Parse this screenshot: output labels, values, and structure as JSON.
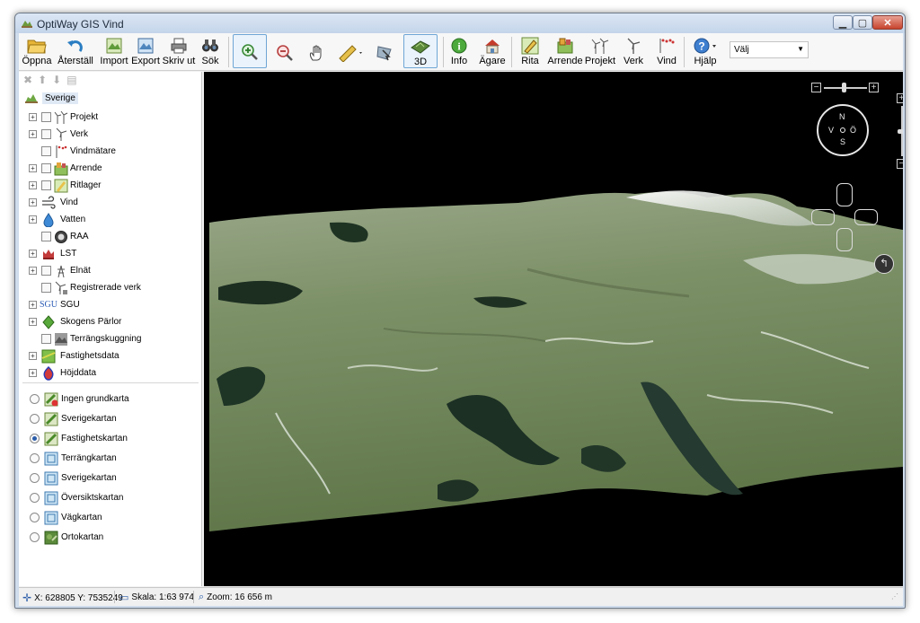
{
  "window": {
    "title": "OptiWay GIS Vind"
  },
  "toolbar": {
    "open": "Öppna",
    "reset": "Återställ",
    "import": "Import",
    "export": "Export",
    "print": "Skriv ut",
    "search": "Sök",
    "view3d": "3D",
    "info": "Info",
    "owner": "Ägare",
    "draw": "Rita",
    "lease": "Arrende",
    "project": "Projekt",
    "turbine": "Verk",
    "wind": "Vind",
    "help": "Hjälp",
    "select_value": "Välj"
  },
  "tree": {
    "root": "Sverige",
    "items": [
      {
        "label": "Projekt"
      },
      {
        "label": "Verk"
      },
      {
        "label": "Vindmätare"
      },
      {
        "label": "Arrende"
      },
      {
        "label": "Ritlager"
      },
      {
        "label": "Vind"
      },
      {
        "label": "Vatten"
      },
      {
        "label": "RAA"
      },
      {
        "label": "LST"
      },
      {
        "label": "Elnät"
      },
      {
        "label": "Registrerade verk"
      },
      {
        "label": "SGU",
        "prefix": "SGU"
      },
      {
        "label": "Skogens Pärlor"
      },
      {
        "label": "Terrängskuggning"
      },
      {
        "label": "Fastighetsdata"
      },
      {
        "label": "Höjddata"
      }
    ]
  },
  "basemaps": {
    "selected": "Fastighetskartan",
    "options": [
      "Ingen grundkarta",
      "Sverigekartan",
      "Fastighetskartan",
      "Terrängkartan",
      "Sverigekartan",
      "Översiktskartan",
      "Vägkartan",
      "Ortokartan"
    ]
  },
  "compass": {
    "n": "N",
    "w": "V",
    "e": "Ö",
    "s": "S"
  },
  "status": {
    "coords": "X: 628805 Y: 7535249",
    "scale": "Skala: 1:63 974",
    "zoom": "Zoom: 16 656 m"
  }
}
